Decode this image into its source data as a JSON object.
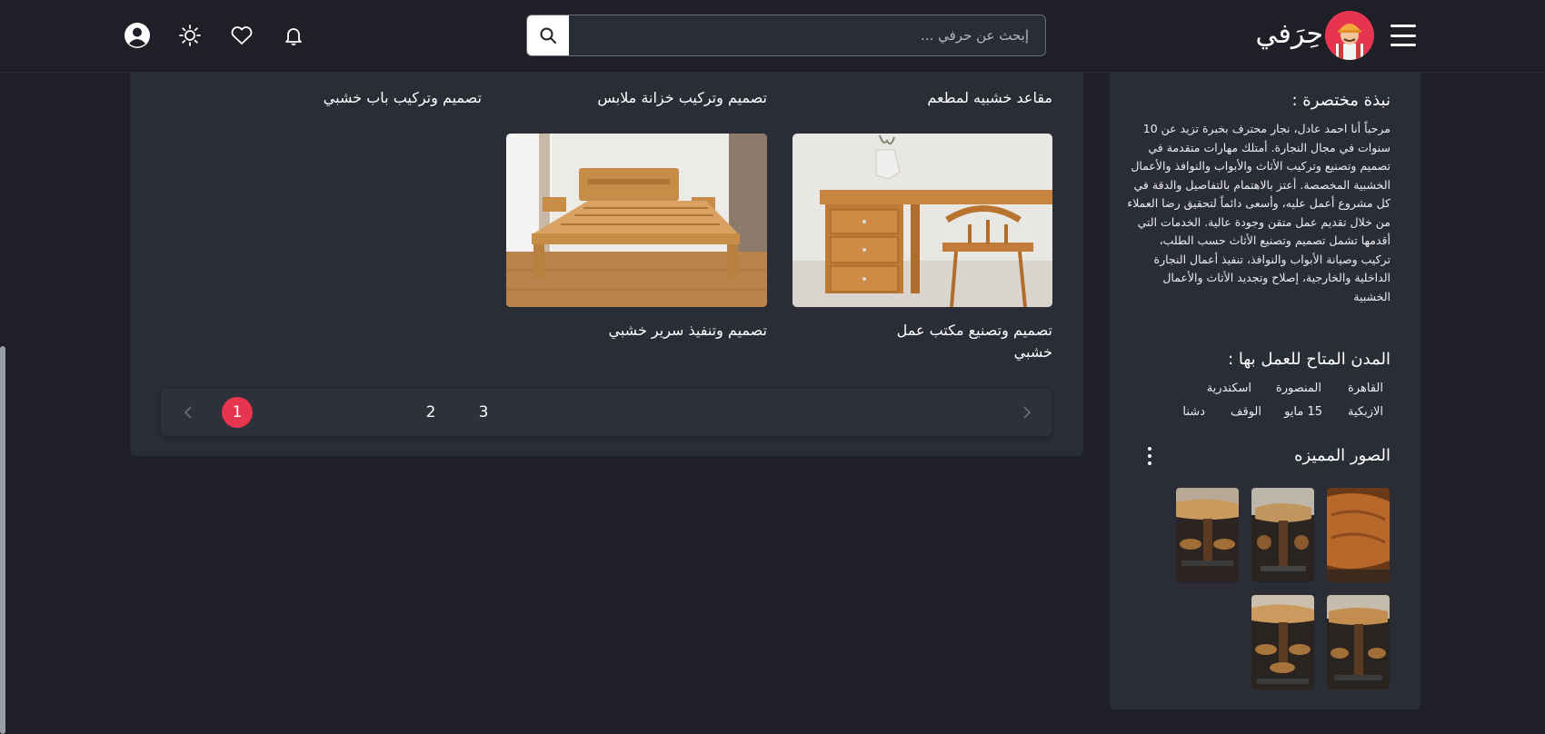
{
  "header": {
    "logo_text": "حِرَفي",
    "search_placeholder": "إبحث عن حرفي ..."
  },
  "icons": {
    "menu": "hamburger-menu-icon",
    "search": "search-icon",
    "notifications": "bell-icon",
    "favorites": "heart-icon",
    "theme": "sun-icon",
    "account": "user-circle-icon",
    "more": "vertical-dots-icon"
  },
  "works": {
    "top_titles": [
      "مقاعد خشبيه لمطعم",
      "تصميم وتركيب خزانة ملابس",
      "تصميم وتركيب باب خشبي"
    ],
    "items": [
      {
        "title": "تصميم وتصنيع مكتب عمل خشبي"
      },
      {
        "title": "تصميم وتنفيذ سرير خشبي"
      }
    ]
  },
  "pagination": {
    "pages": [
      "1",
      "2",
      "3"
    ],
    "active": "1"
  },
  "sidebar": {
    "bio_heading": "نبذة مختصرة :",
    "bio_text": "مرحباً أنا احمد عادل، نجار محترف بخبرة تزيد عن 10 سنوات في مجال النجارة. أمتلك مهارات متقدمة في تصميم وتصنيع وتركيب الأثاث والأبواب والنوافذ والأعمال الخشبية المخصصة. أعتز بالاهتمام بالتفاصيل والدقة في كل مشروع أعمل عليه، وأسعى دائماً لتحقيق رضا العملاء من خلال تقديم عمل متقن وجودة عالية. الخدمات التي أقدمها تشمل تصميم وتصنيع الأثاث حسب الطلب، تركيب وصيانة الأبواب والنوافذ، تنفيذ أعمال النجارة الداخلية والخارجية، إصلاح وتجديد الأثاث والأعمال الخشبية",
    "cities_heading": "المدن المتاح للعمل بها :",
    "cities": [
      "القاهرة",
      "المنصورة",
      "اسكندرية",
      "الازبكية",
      "15 مايو",
      "الوقف",
      "دشنا"
    ],
    "featured_heading": "الصور المميزه"
  },
  "colors": {
    "background": "#1e1f27",
    "card": "#2a2c36",
    "accent": "#e8354f",
    "text": "#ffffff"
  }
}
